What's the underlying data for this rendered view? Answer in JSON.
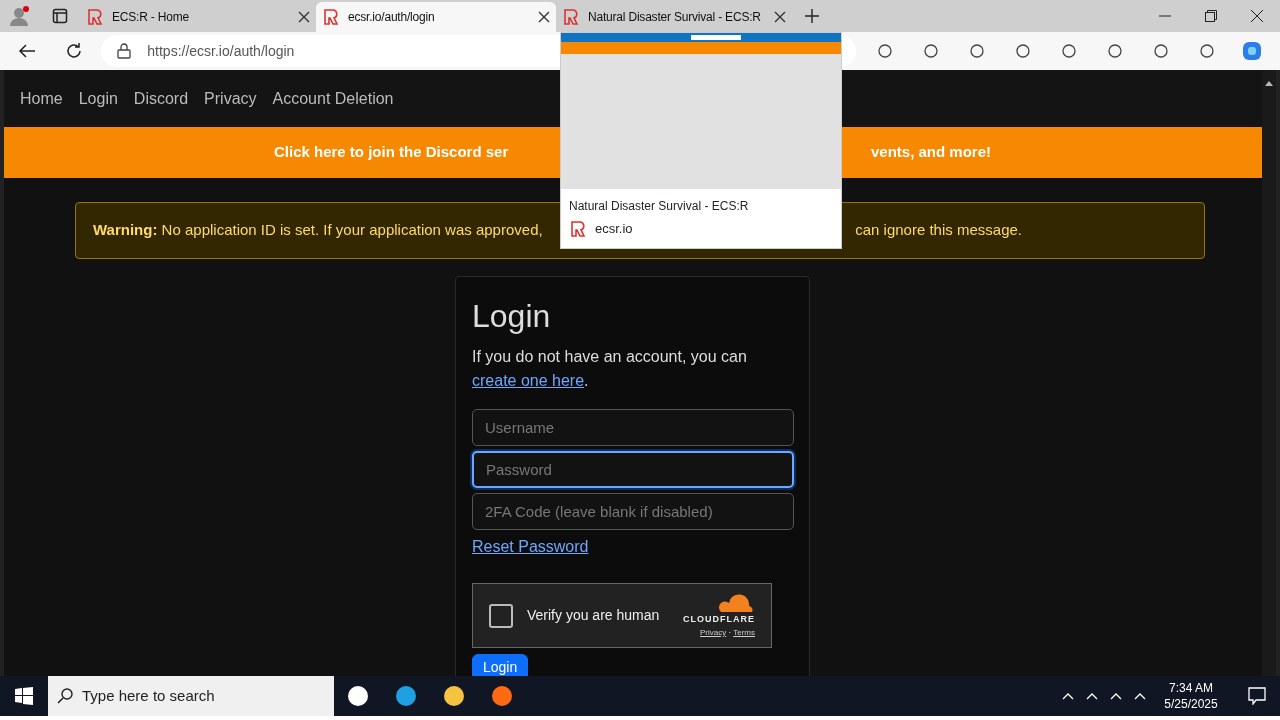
{
  "browser": {
    "tabs": [
      {
        "title": "ECS:R - Home",
        "selected": false
      },
      {
        "title": "ecsr.io/auth/login",
        "selected": true
      },
      {
        "title": "Natural Disaster Survival - ECS:R",
        "selected": false
      }
    ],
    "address": "https://ecsr.io/auth/login",
    "tab_preview": {
      "title": "Natural Disaster Survival - ECS:R",
      "site": "ecsr.io"
    }
  },
  "page": {
    "nav_links": [
      "Home",
      "Login",
      "Discord",
      "Privacy",
      "Account Deletion"
    ],
    "banner": {
      "text_before": "Click here to join the Discord ser",
      "text_after": "vents, and more!"
    },
    "warning": {
      "label": "Warning:",
      "text_before": "No application ID is set. If your application was approved,",
      "text_after": "can ignore this message."
    },
    "login": {
      "title": "Login",
      "intro": "If you do not have an account, you can",
      "link": "create one here",
      "intro_end": ".",
      "fields": [
        {
          "placeholder": "Username",
          "focused": false
        },
        {
          "placeholder": "Password",
          "focused": true
        },
        {
          "placeholder": "2FA Code (leave blank if disabled)",
          "focused": false
        }
      ],
      "reset_link": "Reset Password",
      "captcha": {
        "label": "Verify you are human",
        "checked": false,
        "brand": "CLOUDFLARE",
        "privacy": "Privacy",
        "separator": "·",
        "terms": "Terms"
      },
      "submit": "Login"
    }
  },
  "taskbar": {
    "search_placeholder": "Type here to search",
    "time": "7:34 AM",
    "date": "5/25/2025"
  }
}
